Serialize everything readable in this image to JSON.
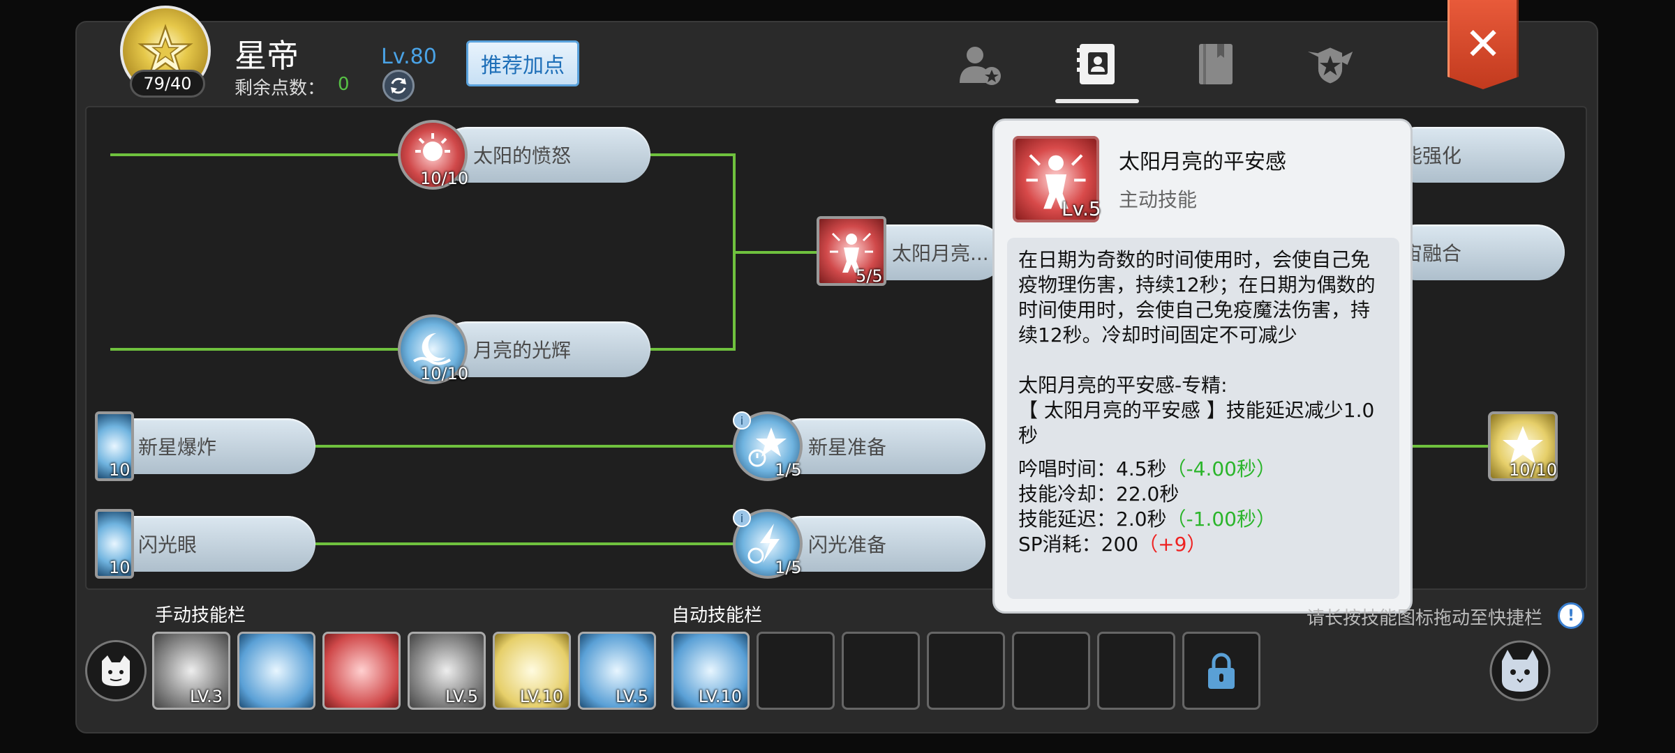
{
  "header": {
    "class_name": "星帝",
    "level_pill": "79/40",
    "points_label": "剩余点数：",
    "points_value": "0",
    "level": "Lv.80",
    "recommend_label": "推荐加点",
    "close_icon": "close-icon",
    "tabs": [
      {
        "icon": "character-star-icon",
        "active": false
      },
      {
        "icon": "skill-book-icon",
        "active": true
      },
      {
        "icon": "book-icon",
        "active": false
      },
      {
        "icon": "emblem-icon",
        "active": false
      }
    ]
  },
  "skills": {
    "sun_anger": {
      "name": "太阳的愤怒",
      "count": "10/10"
    },
    "moon_glow": {
      "name": "月亮的光辉",
      "count": "10/10"
    },
    "sun_moon": {
      "name": "太阳月亮...",
      "count": "5/5"
    },
    "nova_burst": {
      "name": "新星爆炸",
      "count": "10"
    },
    "flash_eye": {
      "name": "闪光眼",
      "count": "10"
    },
    "nova_prep": {
      "name": "新星准备",
      "count": "1/5"
    },
    "flash_prep": {
      "name": "闪光准备",
      "count": "1/5"
    },
    "right_top": {
      "name": "能强化"
    },
    "right_mid": {
      "name": "宙融合"
    },
    "right_star": {
      "count": "10/10"
    }
  },
  "tooltip": {
    "title": "太阳月亮的平安感",
    "type": "主动技能",
    "level": "Lv.5",
    "description": "在日期为奇数的时间使用时，会使自己免疫物理伤害，持续12秒；在日期为偶数的时间使用时，会使自己免疫魔法伤害，持续12秒。冷却时间固定不可减少",
    "spec_title": "太阳月亮的平安感-专精:",
    "spec_desc": "【 太阳月亮的平安感 】技能延迟减少1.0秒",
    "stats": [
      {
        "label": "吟唱时间：4.5秒",
        "delta": "（-4.00秒）",
        "color": "green"
      },
      {
        "label": "技能冷却：22.0秒",
        "delta": "",
        "color": ""
      },
      {
        "label": "技能延迟：2.0秒",
        "delta": "（-1.00秒）",
        "color": "green"
      },
      {
        "label": "SP消耗：200",
        "delta": "（+9）",
        "color": "red"
      }
    ]
  },
  "bottom": {
    "manual_label": "手动技能栏",
    "auto_label": "自动技能栏",
    "hint": "请长按技能图标拖动至快捷栏",
    "manual_slots": [
      {
        "lv": "LV.3",
        "theme": "gray"
      },
      {
        "lv": "",
        "theme": "blue"
      },
      {
        "lv": "",
        "theme": "red"
      },
      {
        "lv": "LV.5",
        "theme": "gray"
      },
      {
        "lv": "LV.10",
        "theme": "gold"
      },
      {
        "lv": "LV.5",
        "theme": "blue"
      }
    ],
    "auto_slots": [
      {
        "lv": "LV.10",
        "theme": "blue"
      },
      {
        "lv": "",
        "theme": "empty"
      },
      {
        "lv": "",
        "theme": "empty"
      },
      {
        "lv": "",
        "theme": "empty"
      },
      {
        "lv": "",
        "theme": "empty"
      },
      {
        "lv": "",
        "theme": "empty"
      },
      {
        "lv": "",
        "theme": "locked"
      }
    ]
  },
  "colors": {
    "accent_green": "#6fc13e",
    "close_red": "#d84a2a",
    "blue": "#4aa3e6"
  }
}
